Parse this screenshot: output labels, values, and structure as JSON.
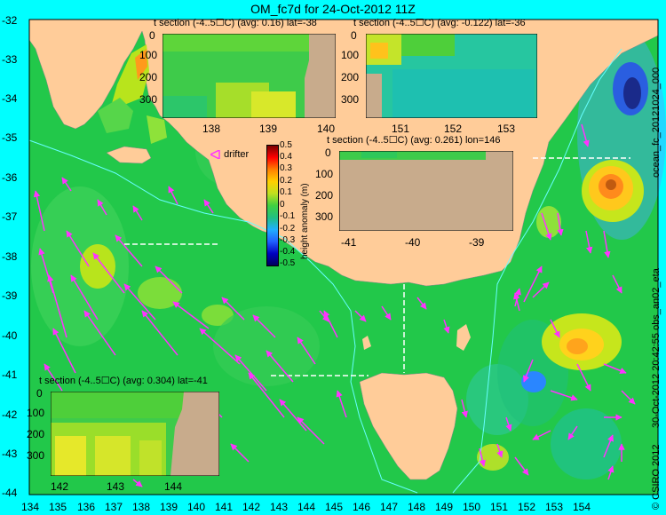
{
  "title": "OM_fc7d for 24-Oct-2012 11Z",
  "lat_ticks": [
    "-32",
    "-33",
    "-34",
    "-35",
    "-36",
    "-37",
    "-38",
    "-39",
    "-40",
    "-41",
    "-42",
    "-43",
    "-44"
  ],
  "lon_ticks": [
    "134",
    "135",
    "136",
    "137",
    "138",
    "139",
    "140",
    "141",
    "142",
    "143",
    "144",
    "145",
    "146",
    "147",
    "148",
    "149",
    "150",
    "151",
    "152",
    "153",
    "154"
  ],
  "side_labels": {
    "run": "ocean_fc_20121024_000",
    "obs": "30-Oct-2012 20:42:55 obs_an02_eta",
    "credit": "© CSIRO 2012"
  },
  "legend": {
    "drifter": "drifter",
    "colorbar_label": "height anomaly (m)",
    "ticks": [
      "0.5",
      "0.4",
      "0.3",
      "0.2",
      "0.1",
      "0",
      "-0.1",
      "-0.2",
      "-0.3",
      "-0.4",
      "-0.5"
    ]
  },
  "insets": {
    "lat38": {
      "title": "t section (-4..5☐C) (avg: 0.16) lat=-38",
      "x_ticks": [
        "138",
        "139",
        "140"
      ],
      "y_ticks": [
        "0",
        "100",
        "200",
        "300"
      ]
    },
    "lat36": {
      "title": "t section (-4..5☐C) (avg: -0.122) lat=-36",
      "x_ticks": [
        "151",
        "152",
        "153"
      ],
      "y_ticks": [
        "0",
        "100",
        "200",
        "300"
      ]
    },
    "lon146": {
      "title": "t section (-4..5☐C) (avg: 0.261) lon=146",
      "x_ticks": [
        "-41",
        "-40",
        "-39"
      ],
      "y_ticks": [
        "0",
        "100",
        "200",
        "300"
      ]
    },
    "lat41": {
      "title": "t section (-4..5☐C) (avg: 0.304) lat=-41",
      "x_ticks": [
        "142",
        "143",
        "144"
      ],
      "y_ticks": [
        "0",
        "100",
        "200",
        "300"
      ]
    }
  },
  "colors": {
    "frame": "#00ffff",
    "sea": "#22c84a",
    "land": "#ffcc99",
    "vectors": "#ff33ff",
    "contour": "#66ffff",
    "section_line": "#ffffff",
    "inset_land": "#c8ab8c"
  }
}
